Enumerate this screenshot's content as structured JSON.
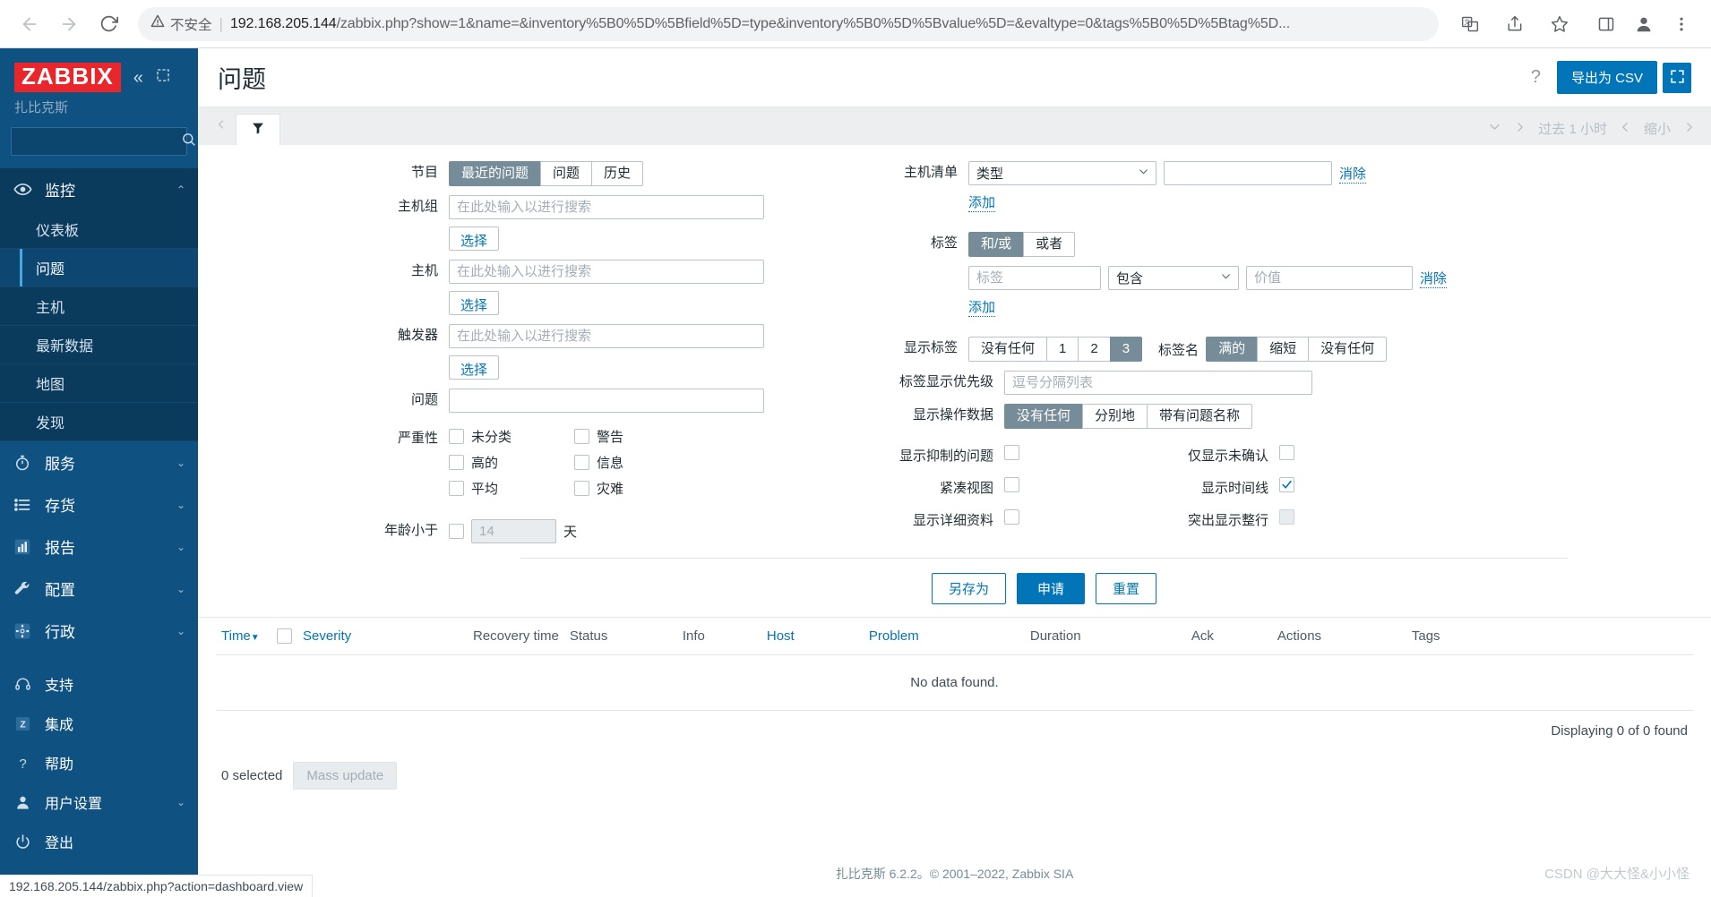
{
  "browser": {
    "security_label": "不安全",
    "url_host": "192.168.205.144",
    "url_rest": "/zabbix.php?show=1&name=&inventory%5B0%5D%5Bfield%5D=type&inventory%5B0%5D%5Bvalue%5D=&evaltype=0&tags%5B0%5D%5Btag%5D...",
    "back_icon": "back-arrow-icon",
    "forward_icon": "forward-arrow-icon",
    "reload_icon": "reload-icon",
    "translate_icon": "translate-icon",
    "share_icon": "share-icon",
    "bookmark_icon": "star-icon",
    "sidepanel_icon": "side-panel-icon",
    "profile_icon": "profile-icon",
    "menu_icon": "kebab-menu-icon"
  },
  "sidebar": {
    "logo": "ZABBIX",
    "subtitle": "扎比克斯",
    "search_placeholder": "",
    "search_value": "",
    "collapse_label": "«",
    "groups": [
      {
        "label": "监控",
        "icon": "eye-icon",
        "expanded": true,
        "items": [
          {
            "label": "仪表板",
            "selected": false
          },
          {
            "label": "问题",
            "selected": true
          },
          {
            "label": "主机",
            "selected": false
          },
          {
            "label": "最新数据",
            "selected": false
          },
          {
            "label": "地图",
            "selected": false
          },
          {
            "label": "发现",
            "selected": false
          }
        ]
      },
      {
        "label": "服务",
        "icon": "stopwatch-icon",
        "expanded": false,
        "items": []
      },
      {
        "label": "存货",
        "icon": "list-icon",
        "expanded": false,
        "items": []
      },
      {
        "label": "报告",
        "icon": "bar-chart-icon",
        "expanded": false,
        "items": []
      },
      {
        "label": "配置",
        "icon": "wrench-icon",
        "expanded": false,
        "items": []
      },
      {
        "label": "行政",
        "icon": "gear-icon",
        "expanded": false,
        "items": []
      }
    ],
    "bottom": [
      {
        "label": "支持",
        "icon": "headset-icon",
        "caret": false
      },
      {
        "label": "集成",
        "icon": "zabbix-z-icon",
        "caret": false
      },
      {
        "label": "帮助",
        "icon": "question-icon",
        "caret": false
      },
      {
        "label": "用户设置",
        "icon": "user-icon",
        "caret": true
      },
      {
        "label": "登出",
        "icon": "power-icon",
        "caret": false
      }
    ]
  },
  "header": {
    "title": "问题",
    "help_icon": "question-mark-icon",
    "export_csv": "导出为 CSV",
    "kiosk_icon": "fullscreen-icon"
  },
  "tabbar": {
    "prev_icon": "chevron-left-icon",
    "filter_icon": "funnel-icon",
    "chevron_down_icon": "chevron-down-icon",
    "chevron_right_icon": "chevron-right-icon",
    "time_range": "过去 1 小时",
    "zoom_prev_icon": "chevron-left-icon",
    "zoom_out": "缩小",
    "zoom_next_icon": "chevron-right-icon"
  },
  "filter": {
    "show_label": "节目",
    "show_options": [
      {
        "label": "最近的问题",
        "active": true
      },
      {
        "label": "问题",
        "active": false
      },
      {
        "label": "历史",
        "active": false
      }
    ],
    "hostgroup_label": "主机组",
    "hostgroup_placeholder": "在此处输入以进行搜索",
    "hostgroup_value": "",
    "host_label": "主机",
    "host_placeholder": "在此处输入以进行搜索",
    "host_value": "",
    "trigger_label": "触发器",
    "trigger_placeholder": "在此处输入以进行搜索",
    "trigger_value": "",
    "select_button": "选择",
    "problem_label": "问题",
    "problem_value": "",
    "severity_label": "严重性",
    "severities": [
      {
        "label": "未分类",
        "checked": false
      },
      {
        "label": "警告",
        "checked": false
      },
      {
        "label": "高的",
        "checked": false
      },
      {
        "label": "信息",
        "checked": false
      },
      {
        "label": "平均",
        "checked": false
      },
      {
        "label": "灾难",
        "checked": false
      }
    ],
    "age_label": "年龄小于",
    "age_checked": false,
    "age_value": "",
    "age_placeholder": "14",
    "age_unit": "天",
    "inventory_label": "主机清单",
    "inventory_field": "类型",
    "inventory_value": "",
    "inventory_remove": "消除",
    "inventory_add": "添加",
    "tags_label": "标签",
    "tag_evaltype": [
      {
        "label": "和/或",
        "active": true
      },
      {
        "label": "或者",
        "active": false
      }
    ],
    "tag_name_placeholder": "标签",
    "tag_name_value": "",
    "tag_operator": "包含",
    "tag_value_placeholder": "价值",
    "tag_value_value": "",
    "tag_remove": "消除",
    "tag_add": "添加",
    "show_tags_label": "显示标签",
    "show_tags_options": [
      {
        "label": "没有任何",
        "active": false
      },
      {
        "label": "1",
        "active": false
      },
      {
        "label": "2",
        "active": false
      },
      {
        "label": "3",
        "active": true
      }
    ],
    "tag_name_label": "标签名",
    "tag_name_options": [
      {
        "label": "满的",
        "active": true
      },
      {
        "label": "缩短",
        "active": false
      },
      {
        "label": "没有任何",
        "active": false
      }
    ],
    "tag_priority_label": "标签显示优先级",
    "tag_priority_placeholder": "逗号分隔列表",
    "tag_priority_value": "",
    "show_opdata_label": "显示操作数据",
    "show_opdata_options": [
      {
        "label": "没有任何",
        "active": true
      },
      {
        "label": "分别地",
        "active": false
      },
      {
        "label": "带有问题名称",
        "active": false
      }
    ],
    "show_suppressed_label": "显示抑制的问题",
    "show_suppressed_checked": false,
    "unack_only_label": "仅显示未确认",
    "unack_only_checked": false,
    "compact_view_label": "紧凑视图",
    "compact_view_checked": false,
    "show_timeline_label": "显示时间线",
    "show_timeline_checked": true,
    "show_details_label": "显示详细资料",
    "show_details_checked": false,
    "highlight_row_label": "突出显示整行",
    "highlight_row_checked": false,
    "highlight_row_disabled": true,
    "save_as": "另存为",
    "apply": "申请",
    "reset": "重置"
  },
  "table": {
    "columns": [
      {
        "label": "Time",
        "link": true,
        "sorted": true
      },
      {
        "label": "Severity",
        "link": true,
        "sorted": false
      },
      {
        "label": "Recovery time",
        "link": false,
        "sorted": false
      },
      {
        "label": "Status",
        "link": false,
        "sorted": false
      },
      {
        "label": "Info",
        "link": false,
        "sorted": false
      },
      {
        "label": "Host",
        "link": true,
        "sorted": false
      },
      {
        "label": "Problem",
        "link": true,
        "sorted": false
      },
      {
        "label": "Duration",
        "link": false,
        "sorted": false
      },
      {
        "label": "Ack",
        "link": false,
        "sorted": false
      },
      {
        "label": "Actions",
        "link": false,
        "sorted": false
      },
      {
        "label": "Tags",
        "link": false,
        "sorted": false
      }
    ],
    "sort_arrow": "▼",
    "no_data": "No data found.",
    "displaying": "Displaying 0 of 0 found",
    "selected_count": "0 selected",
    "mass_update": "Mass update"
  },
  "footer": {
    "copyright": "扎比克斯 6.2.2。© 2001–2022, Zabbix SIA",
    "link_text": "Zabbix SIA",
    "watermark": "CSDN @大大怪&小小怪",
    "status_url": "192.168.205.144/zabbix.php?action=dashboard.view"
  },
  "colors": {
    "accent": "#0275b8",
    "sidebar_bg": "#0f5181",
    "sidebar_sub_bg": "#0a3a5c",
    "logo_red": "#e8262c",
    "segment_active": "#768d99"
  }
}
